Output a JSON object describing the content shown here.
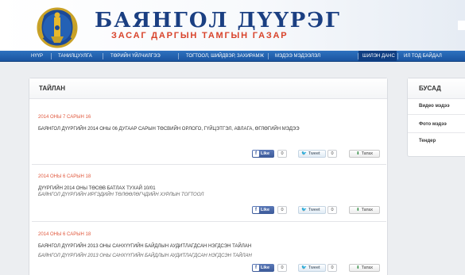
{
  "header": {
    "title": "БАЯНГОЛ ДҮҮРЭГ",
    "subtitle": "ЗАСАГ ДАРГЫН ТАМГЫН ГАЗАР"
  },
  "nav": {
    "items": [
      "НҮҮР",
      "ТАНИЛЦУУЛГА",
      "ТӨРИЙН ҮЙЛЧИЛГЭЭ",
      "ТОГТООЛ, ШИЙДВЭР, ЗАХИРАМЖ",
      "МЭДЭЭ МЭДЭЭЛЭЛ",
      "ШИЛЭН ДАНС",
      "ИЛ ТОД БАЙДАЛ"
    ],
    "active_index": 5
  },
  "main": {
    "title": "ТАЙЛАН",
    "entries": [
      {
        "date": "2014 ОНЫ 7 САРЫН 16",
        "title": "БАЯНГОЛ ДҮҮРГИЙН 2014 ОНЫ 06 ДУГААР САРЫН ТӨСВИЙН ОРЛОГО, ГҮЙЦЭТГЭЛ, АВЛАГА, ӨГЛӨГИЙН МЭДЭЭ",
        "description": ""
      },
      {
        "date": "2014 ОНЫ 6 САРЫН 18",
        "title": "ДҮҮРГИЙН 2014 ОНЫ ТӨСӨВ БАТЛАХ ТУХАЙ 10/01",
        "description": "БАЯНГОЛ ДҮҮРГИЙН ИРГЭДИЙН ТӨЛӨӨЛӨГЧДИЙН ХУРЛЫН ТОГТООЛ"
      },
      {
        "date": "2014 ОНЫ 6 САРЫН 18",
        "title": "БАЯНГОЛ ДҮҮРГИЙН 2013 ОНЫ САНХҮҮГИЙН БАЙДЛЫН АУДИТЛАГДСАН НЭГДСЭН ТАЙЛАН",
        "description": "БАЯНГОЛ ДҮҮРГИЙН 2013 ОНЫ САНХҮҮГИЙН БАЙДЛЫН АУДИТЛАГДСАН НЭГДСЭН ТАЙЛАН"
      }
    ],
    "share": {
      "like_label": "Like",
      "like_count": "0",
      "tweet_label": "Tweet",
      "tweet_count": "0",
      "download_label": "Татах"
    }
  },
  "sidebar": {
    "title": "БУСАД",
    "items": [
      "Видео мэдээ",
      "Фото мэдээ",
      "Тендер"
    ]
  },
  "colors": {
    "brand_blue": "#1b3f82",
    "accent_red": "#d8432b",
    "nav_blue": "#1a54a0",
    "date_orange": "#e0573c"
  }
}
